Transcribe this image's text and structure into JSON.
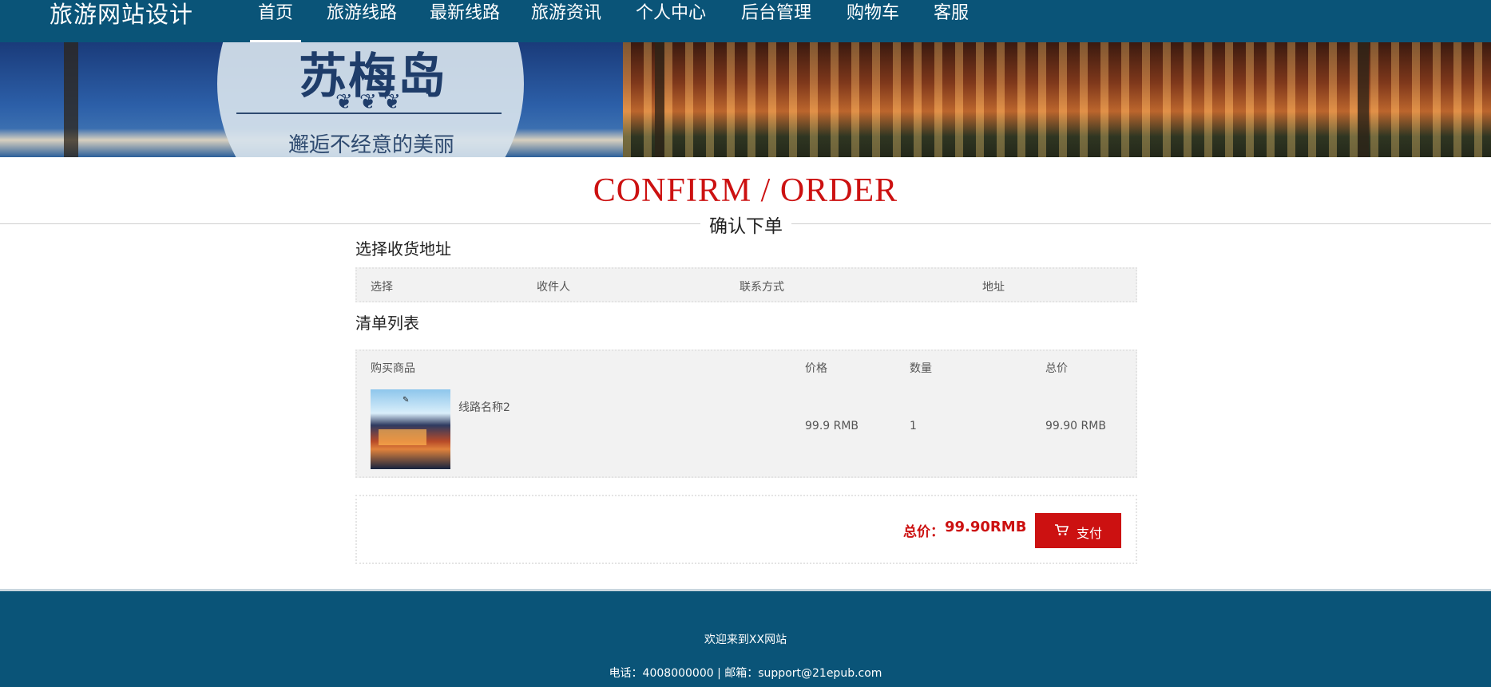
{
  "header": {
    "brand": "旅游网站设计",
    "nav": [
      {
        "label": "首页",
        "active": true
      },
      {
        "label": "旅游线路"
      },
      {
        "label": "最新线路"
      },
      {
        "label": "旅游资讯"
      },
      {
        "label": "个人中心"
      },
      {
        "label": "后台管理"
      },
      {
        "label": "购物车"
      },
      {
        "label": "客服"
      }
    ]
  },
  "banner": {
    "logo_text": "苏梅岛",
    "slogan": "邂逅不经意的美丽"
  },
  "page": {
    "title": "CONFIRM / ORDER",
    "subtitle": "确认下单"
  },
  "address_section": {
    "title": "选择收货地址",
    "columns": [
      "选择",
      "收件人",
      "联系方式",
      "地址"
    ]
  },
  "order_section": {
    "title": "清单列表",
    "columns": [
      "购买商品",
      "价格",
      "数量",
      "总价"
    ],
    "items": [
      {
        "name": "线路名称2",
        "price": "99.9 RMB",
        "quantity": "1",
        "total": "99.90 RMB"
      }
    ]
  },
  "summary": {
    "total_label": "总价：",
    "total_value": "99.90RMB",
    "pay_label": "支付",
    "pay_icon": "cart-icon"
  },
  "footer": {
    "welcome": "欢迎来到XX网站",
    "contact": "电话：4008000000 | 邮箱：support@21epub.com"
  },
  "colors": {
    "nav_bg": "#0a5478",
    "accent": "#cc1111"
  }
}
